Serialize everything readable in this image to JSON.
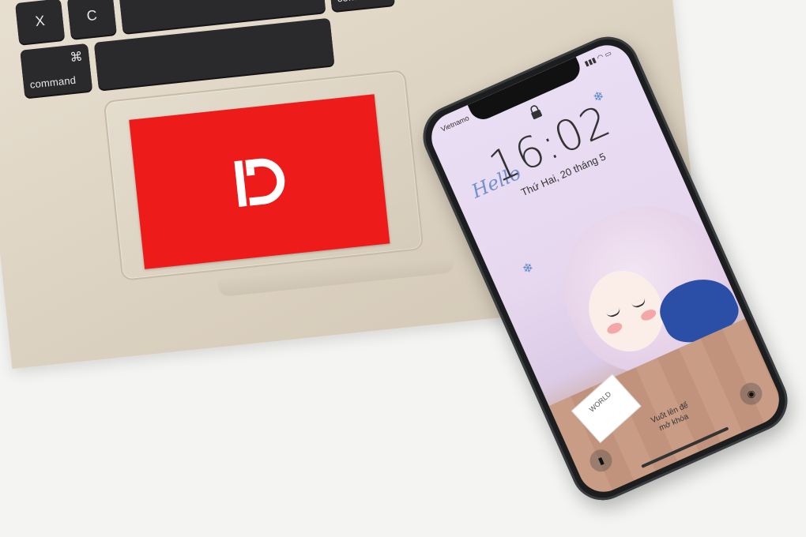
{
  "keyboard": {
    "keys": [
      {
        "main": "X"
      },
      {
        "main": "C"
      },
      {
        "sym": "⌘",
        "word": "command"
      },
      {
        "word": "command"
      }
    ]
  },
  "logo": {
    "brand_color": "#ee1b1b",
    "icon": "d-logo"
  },
  "phone": {
    "carrier": "Vietnamo",
    "time": "16:02",
    "date": "Thứ Hai, 20 tháng 5",
    "wallpaper_text": "Hello",
    "card_text": "WORLD",
    "swipe_text_line1": "Vuốt lên để",
    "swipe_text_line2": "mở khóa"
  }
}
